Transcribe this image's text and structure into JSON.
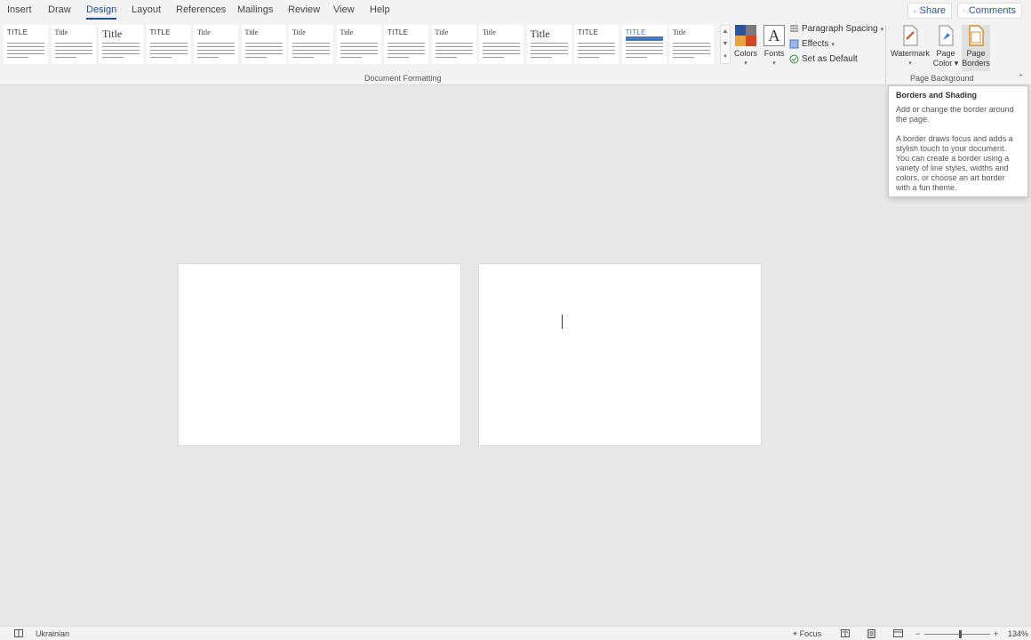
{
  "tabs": [
    {
      "label": "Insert"
    },
    {
      "label": "Draw"
    },
    {
      "label": "Design",
      "active": true
    },
    {
      "label": "Layout"
    },
    {
      "label": "References"
    },
    {
      "label": "Mailings"
    },
    {
      "label": "Review"
    },
    {
      "label": "View"
    },
    {
      "label": "Help"
    }
  ],
  "topbar": {
    "share": "Share",
    "comments": "Comments"
  },
  "styles_gallery": {
    "thumbs": [
      {
        "title": "TITLE"
      },
      {
        "title": "Title"
      },
      {
        "title": "Title"
      },
      {
        "title": "TITLE"
      },
      {
        "title": "Title"
      },
      {
        "title": "Title"
      },
      {
        "title": "Title"
      },
      {
        "title": "Title"
      },
      {
        "title": "TITLE"
      },
      {
        "title": "Title"
      },
      {
        "title": "Title"
      },
      {
        "title": "Title"
      },
      {
        "title": "TITLE"
      },
      {
        "title": "TITLE"
      },
      {
        "title": "Title"
      }
    ]
  },
  "document_formatting": {
    "label": "Document Formatting",
    "colors": "Colors",
    "fonts": "Fonts",
    "paragraph_spacing": "Paragraph Spacing",
    "effects": "Effects",
    "set_as_default": "Set as Default"
  },
  "page_background": {
    "label": "Page Background",
    "watermark": "Watermark",
    "page_color": "Page Color",
    "page_borders_line1": "Page",
    "page_borders_line2": "Borders"
  },
  "tooltip": {
    "title": "Borders and Shading",
    "p1": "Add or change the border around the page.",
    "p2": "A border draws focus and adds a stylish touch to your document. You can create a border using a variety of line styles, widths and colors, or choose an art border with a fun theme."
  },
  "statusbar": {
    "language": "Ukrainian",
    "focus": "Focus",
    "zoom": "134%"
  },
  "colors": {
    "accent": "#1f4e9a",
    "theme_blue": "#4a74c9"
  }
}
